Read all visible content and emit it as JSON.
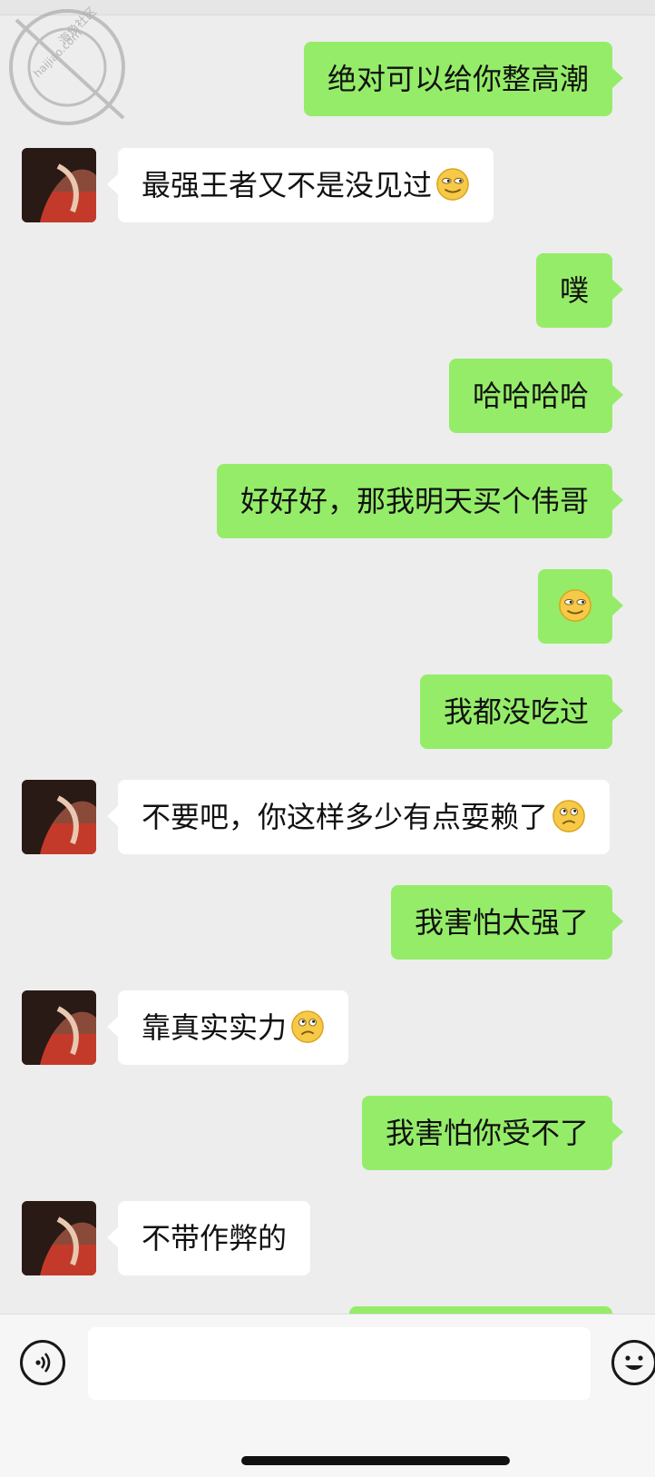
{
  "watermark": {
    "line1": "海角社区",
    "line2": "haijiao.com"
  },
  "messages": [
    {
      "side": "me",
      "text": "绝对可以给你整高潮"
    },
    {
      "side": "them",
      "text": "最强王者又不是没见过",
      "emoji": "grimace-smile"
    },
    {
      "side": "me",
      "text": "噗"
    },
    {
      "side": "me",
      "text": "哈哈哈哈"
    },
    {
      "side": "me",
      "text": "好好好，那我明天买个伟哥"
    },
    {
      "side": "me",
      "text": "",
      "emoji": "grimace-smile"
    },
    {
      "side": "me",
      "text": "我都没吃过"
    },
    {
      "side": "them",
      "text": "不要吧，你这样多少有点耍赖了",
      "emoji": "confused"
    },
    {
      "side": "me",
      "text": "我害怕太强了"
    },
    {
      "side": "them",
      "text": "靠真实实力",
      "emoji": "confused"
    },
    {
      "side": "me",
      "text": "我害怕你受不了"
    },
    {
      "side": "them",
      "text": "不带作弊的"
    }
  ],
  "input_bar": {
    "placeholder": "",
    "voice_icon": "voice-icon",
    "emoji_icon": "smile-icon"
  },
  "colors": {
    "me_bubble": "#95ec69",
    "them_bubble": "#ffffff",
    "background": "#ededed"
  }
}
